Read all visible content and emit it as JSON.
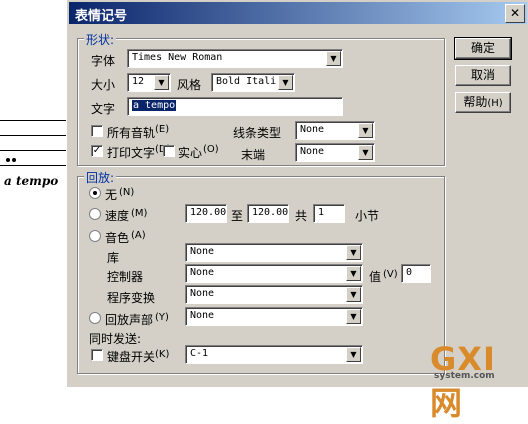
{
  "background": {
    "tempo_text": "a tempo"
  },
  "watermark": {
    "brand": "GXI网",
    "site": "system.com"
  },
  "dialog": {
    "title": "表情记号",
    "close_symbol": "✕",
    "shape_group": {
      "legend": "形状:",
      "font_label": "字体",
      "font_value": "Times New Roman",
      "size_label": "大小",
      "size_value": "12",
      "style_label": "风格",
      "style_value": "Bold Itali",
      "text_label": "文字",
      "text_value": "a tempo",
      "all_tracks_label": "所有音轨",
      "all_tracks_key": "(E)",
      "all_tracks_checked": false,
      "print_text_label": "打印文字",
      "print_text_key": "(D)",
      "print_text_checked": true,
      "solid_label": "实心",
      "solid_key": "(O)",
      "solid_checked": false,
      "line_type_label": "线条类型",
      "line_type_value": "None",
      "end_label": "末端",
      "end_value": "None"
    },
    "playback_group": {
      "legend": "回放:",
      "none_label": "无",
      "none_key": "(N)",
      "none_selected": true,
      "speed_label": "速度",
      "speed_key": "(M)",
      "speed_from": "120.00",
      "to_label": "至",
      "speed_to": "120.00",
      "total_label": "共",
      "measures_value": "1",
      "measures_label": "小节",
      "timbre_label": "音色",
      "timbre_key": "(A)",
      "library_label": "库",
      "library_value": "None",
      "controller_label": "控制器",
      "controller_value": "None",
      "value_label": "值",
      "value_key": "(V)",
      "controller_amount": "0",
      "program_label": "程序变换",
      "program_value": "None",
      "voice_label": "回放声部",
      "voice_key": "(Y)",
      "voice_value": "None",
      "simultaneous_label": "同时发送:",
      "keyswitch_label": "键盘开关",
      "keyswitch_key": "(K)",
      "keyswitch_checked": false,
      "keyswitch_value": "C-1"
    },
    "buttons": {
      "ok": "确定",
      "cancel": "取消",
      "help": "帮助",
      "help_key": "(H)"
    },
    "arrow_glyph": "▼"
  }
}
